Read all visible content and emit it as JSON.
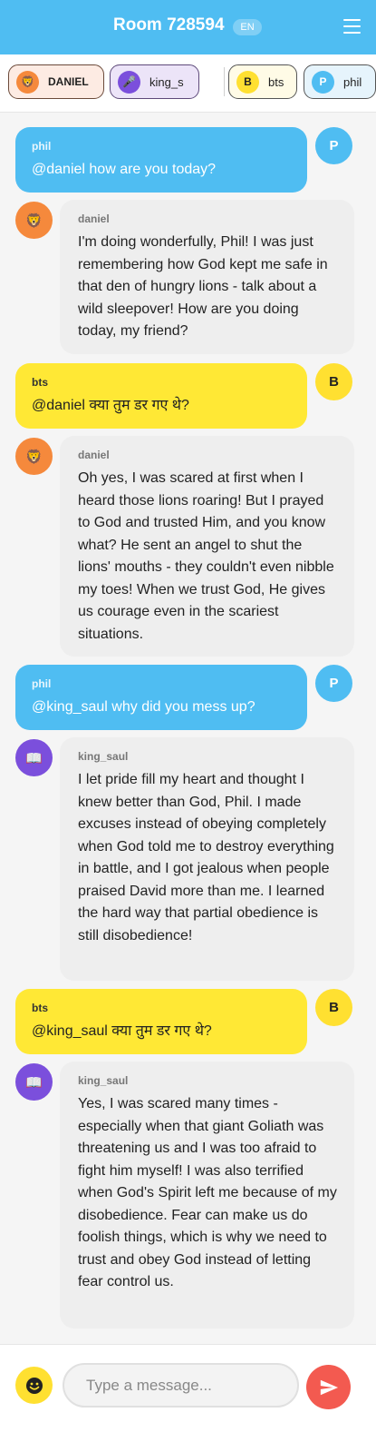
{
  "header": {
    "title": "Room 728594",
    "lang": "EN",
    "menu_icon": "hamburger-menu-icon"
  },
  "participants": [
    {
      "initial": "🦁",
      "label": "DANIEL"
    },
    {
      "initial": "🎤",
      "label": "king_s"
    },
    {
      "initial": "B",
      "label": "bts"
    },
    {
      "initial": "P",
      "label": "phil"
    }
  ],
  "messages": [
    {
      "sender": "phil",
      "avatar": "P",
      "text": "@daniel how are you today?"
    },
    {
      "sender": "daniel",
      "avatar": "🦁",
      "text": "I'm doing wonderfully, Phil! I was just remembering how God kept me safe in that den of hungry lions - talk about a wild sleepover! How are you doing today, my friend?"
    },
    {
      "sender": "bts",
      "avatar": "B",
      "text": "@daniel क्या तुम डर गए थे?"
    },
    {
      "sender": "daniel",
      "avatar": "🦁",
      "text": "Oh yes, I was scared at first when I heard those lions roaring! But I prayed to God and trusted Him, and you know what? He sent an angel to shut the lions' mouths - they couldn't even nibble my toes! When we trust God, He gives us courage even in the scariest situations."
    },
    {
      "sender": "phil",
      "avatar": "P",
      "text": "@king_saul why did you mess up?"
    },
    {
      "sender": "king_saul",
      "avatar": "📖",
      "text": "I let pride fill my heart and thought I knew better than God, Phil. I made excuses instead of obeying completely when God told me to destroy everything in battle, and I got jealous when people praised David more than me. I learned the hard way that partial obedience is still disobedience!"
    },
    {
      "sender": "bts",
      "avatar": "B",
      "text": "@king_saul क्या तुम डर गए थे?"
    },
    {
      "sender": "king_saul",
      "avatar": "📖",
      "text": "Yes, I was scared many times - especially when that giant Goliath was threatening us and I was too afraid to fight him myself! I was also terrified when God's Spirit left me because of my disobedience. Fear can make us do foolish things, which is why we need to trust and obey God instead of letting fear control us."
    }
  ],
  "composer": {
    "placeholder": "Type a message...",
    "emoji_icon": "smiley-face-icon",
    "send_icon": "send-arrow-icon"
  },
  "colors": {
    "primary": "#4fbdf2",
    "bts": "#ffe835",
    "daniel": "#f5893c",
    "king_saul": "#7b4fdc",
    "send": "#f35a50",
    "bot_bubble": "#eeeeee"
  }
}
